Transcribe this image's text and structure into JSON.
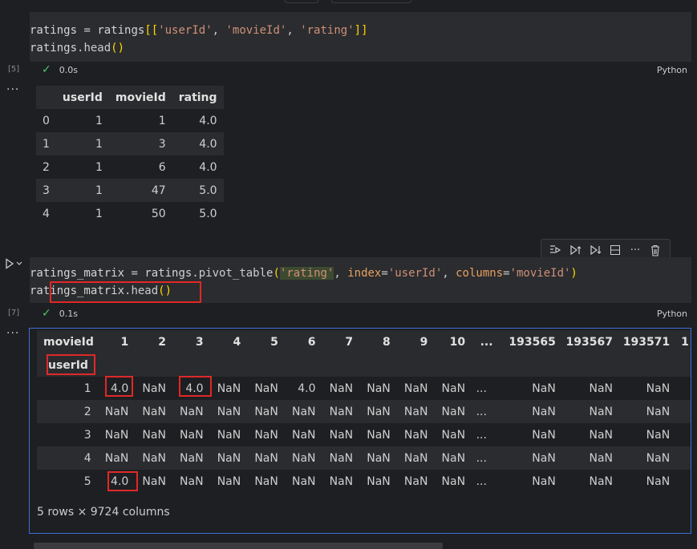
{
  "cell1": {
    "code_parts": [
      "ratings",
      " = ",
      "ratings",
      "[[",
      "'userId'",
      ", ",
      "'movieId'",
      ", ",
      "'rating'",
      "]]"
    ],
    "code_line2": [
      "ratings",
      ".head",
      "()"
    ],
    "exec_count": "[5]",
    "duration": "0.0s",
    "language": "Python"
  },
  "output1": {
    "headers": [
      "",
      "userId",
      "movieId",
      "rating"
    ],
    "rows": [
      [
        "0",
        "1",
        "1",
        "4.0"
      ],
      [
        "1",
        "1",
        "3",
        "4.0"
      ],
      [
        "2",
        "1",
        "6",
        "4.0"
      ],
      [
        "3",
        "1",
        "47",
        "5.0"
      ],
      [
        "4",
        "1",
        "50",
        "5.0"
      ]
    ]
  },
  "toolbar": {
    "icons": [
      "run-by-line-icon",
      "execute-above-icon",
      "execute-below-icon",
      "split-cell-icon",
      "more-icon",
      "delete-icon"
    ]
  },
  "cell2": {
    "line1": {
      "a": "ratings_matrix",
      "b": " = ",
      "c": "ratings",
      "d": ".pivot_table",
      "e": "(",
      "f": "'rating'",
      "g": ", ",
      "h": "index",
      "i": "=",
      "j": "'userId'",
      "k": ", ",
      "l": "columns",
      "m": "=",
      "n": "'movieId'",
      "o": ")"
    },
    "line2": [
      "ratings_matrix",
      ".head",
      "()"
    ],
    "exec_count": "[7]",
    "duration": "0.1s",
    "language": "Python"
  },
  "output2": {
    "col_header_label": "movieId",
    "columns": [
      "1",
      "2",
      "3",
      "4",
      "5",
      "6",
      "7",
      "8",
      "9",
      "10",
      "...",
      "193565",
      "193567",
      "193571",
      "1"
    ],
    "index_label": "userId",
    "rows": [
      {
        "idx": "1",
        "cells": [
          "4.0",
          "NaN",
          "4.0",
          "NaN",
          "NaN",
          "4.0",
          "NaN",
          "NaN",
          "NaN",
          "NaN",
          "...",
          "NaN",
          "NaN",
          "NaN"
        ]
      },
      {
        "idx": "2",
        "cells": [
          "NaN",
          "NaN",
          "NaN",
          "NaN",
          "NaN",
          "NaN",
          "NaN",
          "NaN",
          "NaN",
          "NaN",
          "...",
          "NaN",
          "NaN",
          "NaN"
        ]
      },
      {
        "idx": "3",
        "cells": [
          "NaN",
          "NaN",
          "NaN",
          "NaN",
          "NaN",
          "NaN",
          "NaN",
          "NaN",
          "NaN",
          "NaN",
          "...",
          "NaN",
          "NaN",
          "NaN"
        ]
      },
      {
        "idx": "4",
        "cells": [
          "NaN",
          "NaN",
          "NaN",
          "NaN",
          "NaN",
          "NaN",
          "NaN",
          "NaN",
          "NaN",
          "NaN",
          "...",
          "NaN",
          "NaN",
          "NaN"
        ]
      },
      {
        "idx": "5",
        "cells": [
          "4.0",
          "NaN",
          "NaN",
          "NaN",
          "NaN",
          "NaN",
          "NaN",
          "NaN",
          "NaN",
          "NaN",
          "...",
          "NaN",
          "NaN",
          "NaN"
        ]
      }
    ],
    "summary": "5 rows × 9724 columns"
  }
}
